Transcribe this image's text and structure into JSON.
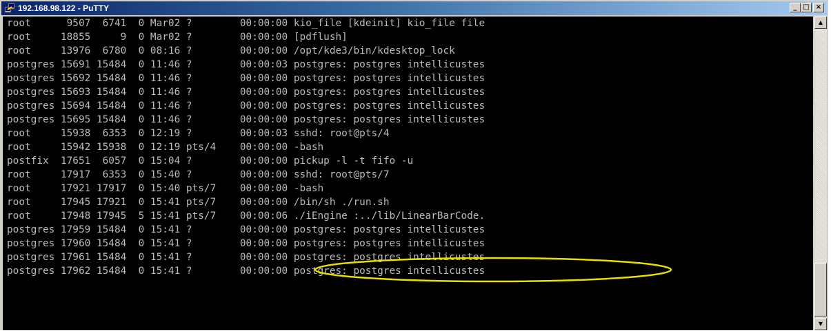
{
  "window": {
    "title": "192.168.98.122 - PuTTY",
    "minimize_glyph": "_",
    "maximize_glyph": "□",
    "close_glyph": "×"
  },
  "terminal": {
    "lines": [
      "root      9507  6741  0 Mar02 ?        00:00:00 kio_file [kdeinit] kio_file file",
      "root     18855     9  0 Mar02 ?        00:00:00 [pdflush]",
      "root     13976  6780  0 08:16 ?        00:00:00 /opt/kde3/bin/kdesktop_lock",
      "postgres 15691 15484  0 11:46 ?        00:00:03 postgres: postgres intellicustes",
      "postgres 15692 15484  0 11:46 ?        00:00:00 postgres: postgres intellicustes",
      "postgres 15693 15484  0 11:46 ?        00:00:00 postgres: postgres intellicustes",
      "postgres 15694 15484  0 11:46 ?        00:00:00 postgres: postgres intellicustes",
      "postgres 15695 15484  0 11:46 ?        00:00:00 postgres: postgres intellicustes",
      "root     15938  6353  0 12:19 ?        00:00:03 sshd: root@pts/4",
      "root     15942 15938  0 12:19 pts/4    00:00:00 -bash",
      "postfix  17651  6057  0 15:04 ?        00:00:00 pickup -l -t fifo -u",
      "root     17917  6353  0 15:40 ?        00:00:00 sshd: root@pts/7",
      "root     17921 17917  0 15:40 pts/7    00:00:00 -bash",
      "root     17945 17921  0 15:41 pts/7    00:00:00 /bin/sh ./run.sh",
      "root     17948 17945  5 15:41 pts/7    00:00:06 ./iEngine :../lib/LinearBarCode.",
      "postgres 17959 15484  0 15:41 ?        00:00:00 postgres: postgres intellicustes",
      "postgres 17960 15484  0 15:41 ?        00:00:00 postgres: postgres intellicustes",
      "postgres 17961 15484  0 15:41 ?        00:00:00 postgres: postgres intellicustes",
      "postgres 17962 15484  0 15:41 ?        00:00:00 postgres: postgres intellicustes"
    ],
    "text_color": "#bbbbbb",
    "background": "#000000"
  },
  "annotation": {
    "shape": "ellipse",
    "color": "#e8e000",
    "highlighted_line": 14
  },
  "scrollbar": {
    "up_glyph": "▲",
    "down_glyph": "▼",
    "position": "bottom"
  },
  "icons": {
    "app": "putty-icon"
  }
}
